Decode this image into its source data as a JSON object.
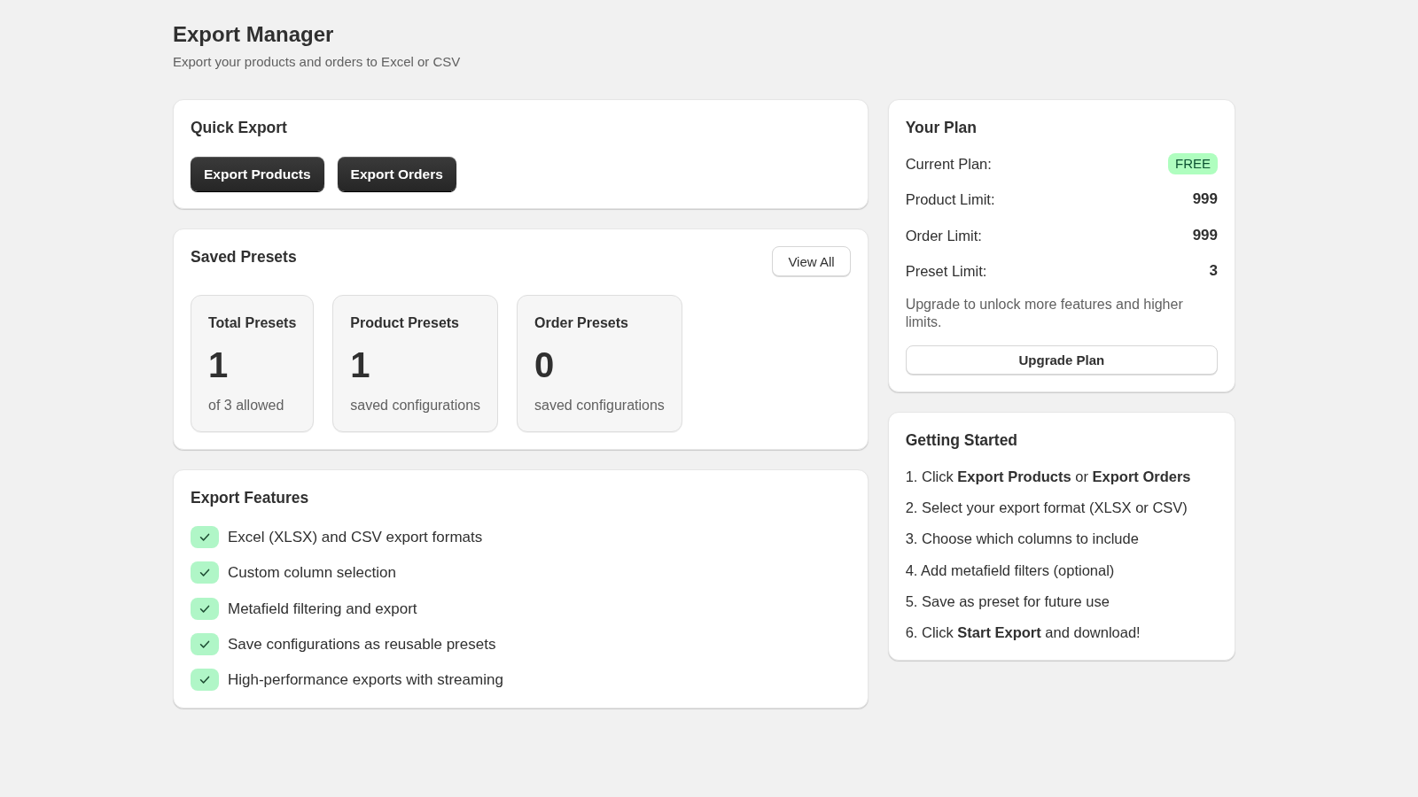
{
  "header": {
    "title": "Export Manager",
    "subtitle": "Export your products and orders to Excel or CSV"
  },
  "quick_export": {
    "title": "Quick Export",
    "buttons": [
      "Export Products",
      "Export Orders"
    ]
  },
  "saved_presets": {
    "title": "Saved Presets",
    "view_all_button": "View All",
    "stats": [
      {
        "label": "Total Presets",
        "value": "1",
        "caption": "of 3 allowed"
      },
      {
        "label": "Product Presets",
        "value": "1",
        "caption": "saved configurations"
      },
      {
        "label": "Order Presets",
        "value": "0",
        "caption": "saved configurations"
      }
    ]
  },
  "export_features": {
    "title": "Export Features",
    "items": [
      "Excel (XLSX) and CSV export formats",
      "Custom column selection",
      "Metafield filtering and export",
      "Save configurations as reusable presets",
      "High-performance exports with streaming"
    ]
  },
  "plan": {
    "title": "Your Plan",
    "rows": [
      {
        "label": "Current Plan:",
        "value": "FREE",
        "kind": "badge"
      },
      {
        "label": "Product Limit:",
        "value": "999",
        "kind": "number"
      },
      {
        "label": "Order Limit:",
        "value": "999",
        "kind": "number"
      },
      {
        "label": "Preset Limit:",
        "value": "3",
        "kind": "number"
      }
    ],
    "note": "Upgrade to unlock more features and higher limits.",
    "upgrade_button": "Upgrade Plan"
  },
  "getting_started": {
    "title": "Getting Started",
    "steps": [
      "1. Click **Export Products** or **Export Orders**",
      "2. Select your export format (XLSX or CSV)",
      "3. Choose which columns to include",
      "4. Add metafield filters (optional)",
      "5. Save as preset for future use",
      "6. Click **Start Export** and download!"
    ]
  }
}
